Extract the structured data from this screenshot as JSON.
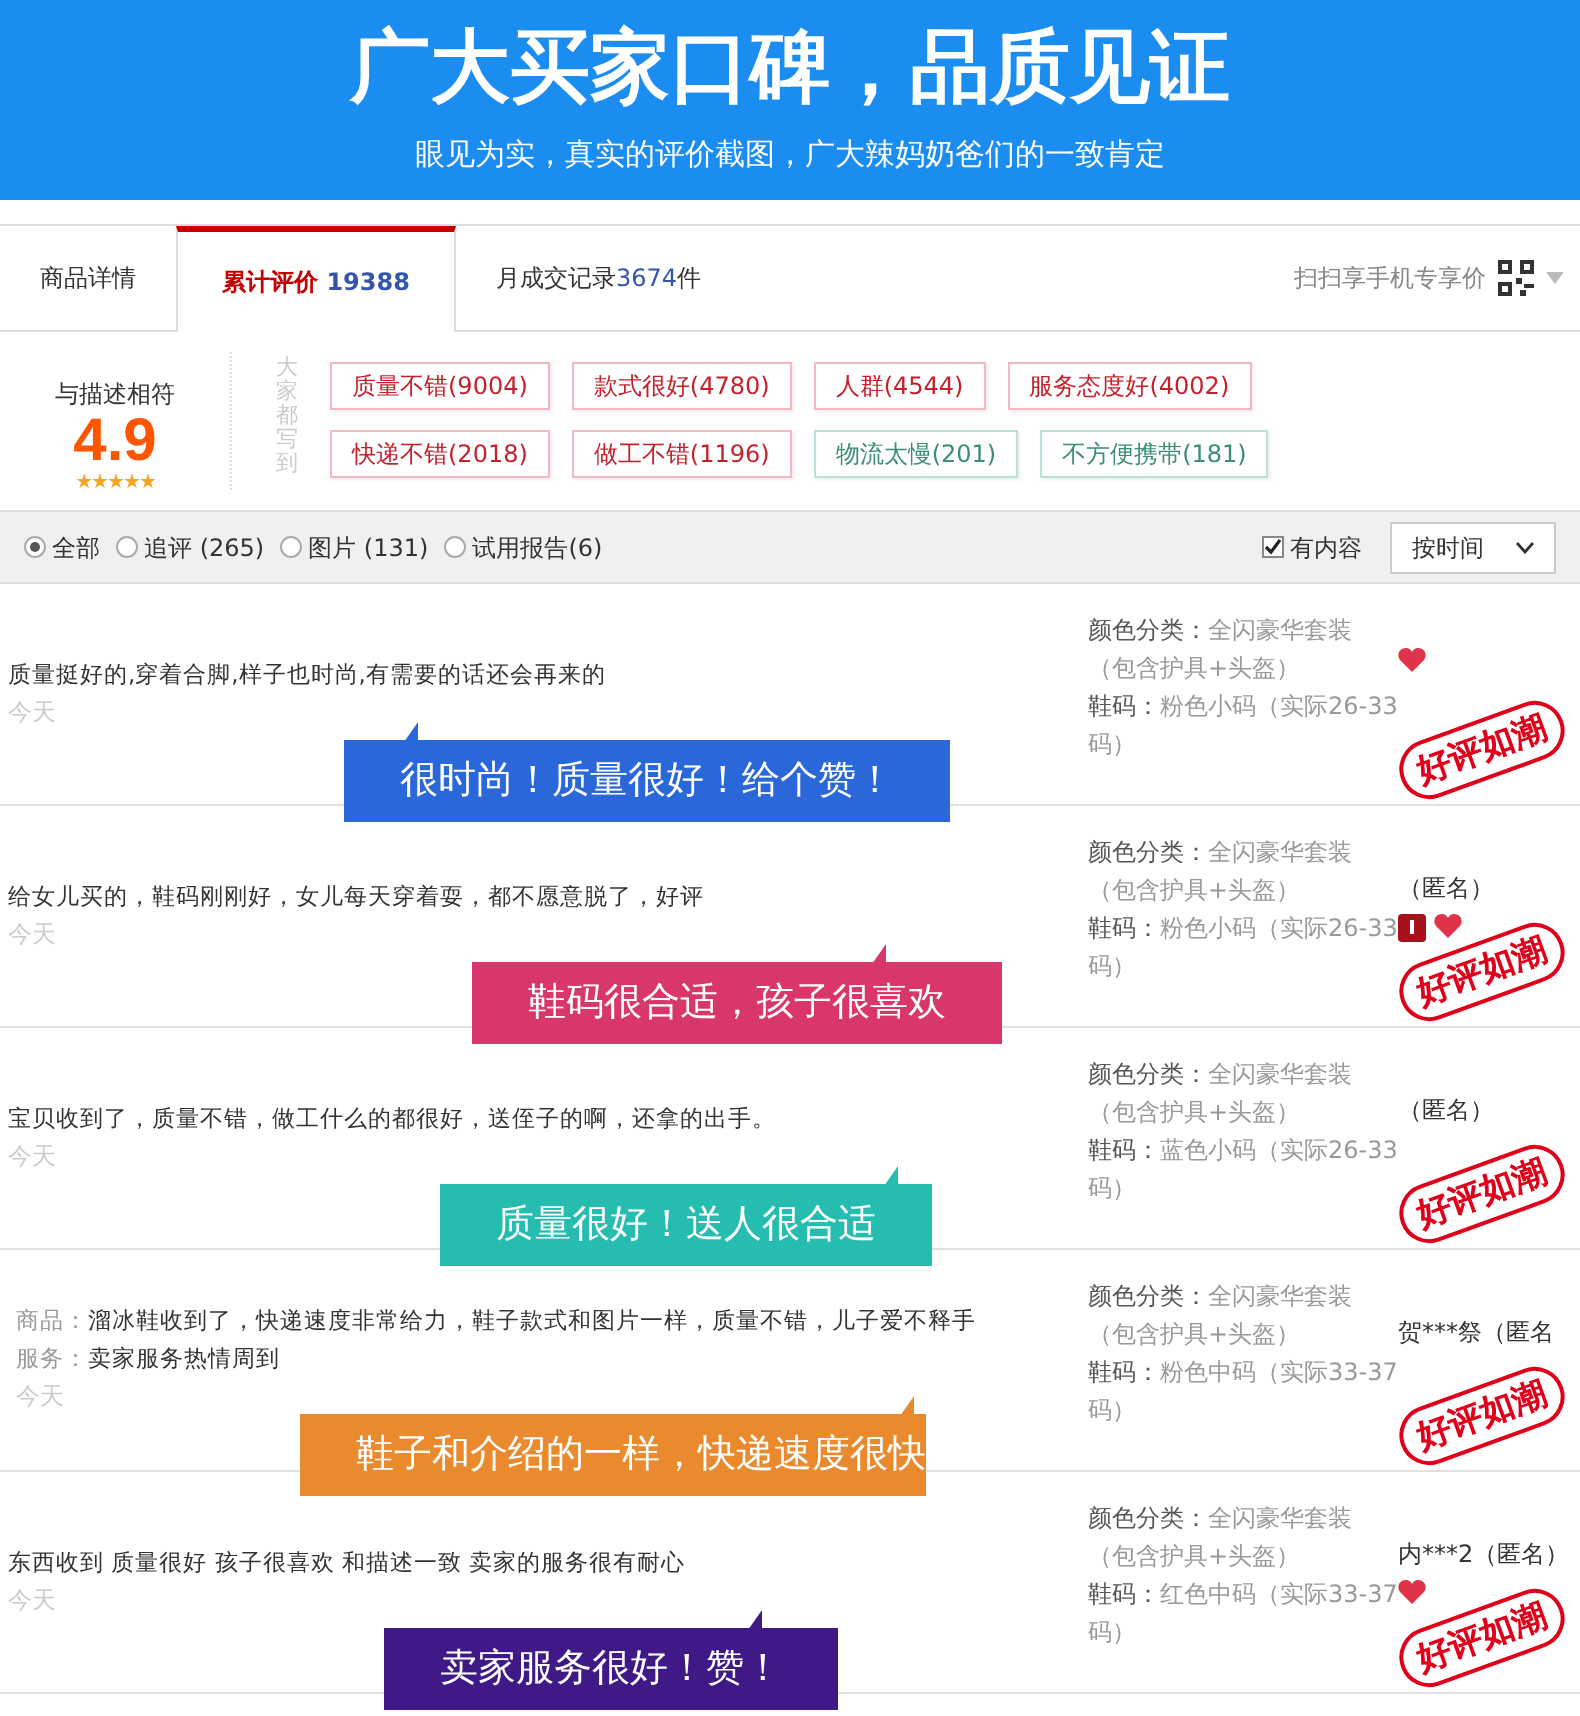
{
  "banner": {
    "title": "广大买家口碑，品质见证",
    "subtitle": "眼见为实，真实的评价截图，广大辣妈奶爸们的一致肯定"
  },
  "tabs": [
    {
      "label": "商品详情",
      "selected": false
    },
    {
      "label": "累计评价",
      "count": "19388",
      "selected": true
    },
    {
      "label": "月成交记录",
      "count": "3674",
      "suffix": "件",
      "selected": false
    }
  ],
  "mobile_price": "扫扫享手机专享价",
  "summary": {
    "label": "与描述相符",
    "score": "4.9",
    "stars": 5,
    "tags_title": "大家都写到"
  },
  "tags": [
    {
      "label": "质量不错(9004)",
      "color": "#c4212c"
    },
    {
      "label": "款式很好(4780)",
      "color": "#c4212c"
    },
    {
      "label": "人群(4544)",
      "color": "#c4212c"
    },
    {
      "label": "服务态度好(4002)",
      "color": "#c4212c"
    },
    {
      "label": "快递不错(2018)",
      "color": "#c4212c"
    },
    {
      "label": "做工不错(1196)",
      "color": "#c4212c"
    },
    {
      "label": "物流太慢(201)",
      "color": "#3b8c78"
    },
    {
      "label": "不方便携带(181)",
      "color": "#3b8c78"
    }
  ],
  "filters": [
    {
      "label": "全部",
      "selected": true
    },
    {
      "label": "追评 (265)",
      "selected": false
    },
    {
      "label": "图片 (131)",
      "selected": false
    },
    {
      "label": "试用报告(6)",
      "selected": false
    }
  ],
  "has_content": {
    "label": "有内容",
    "checked": true
  },
  "sort": "按时间",
  "reviews": [
    {
      "lines": [
        {
          "text": "质量挺好的,穿着合脚,样子也时尚,有需要的话还会再来的"
        }
      ],
      "date": "今天",
      "callout": "很时尚！质量很好！给个赞！",
      "color": "#2a67d8",
      "sku": [
        {
          "label": "颜色分类：",
          "value": "全闪豪华套装（包含护具+头盔）"
        },
        {
          "label": "鞋码：",
          "value": "粉色小码（实际26-33码）"
        }
      ],
      "badge": false,
      "heart": true,
      "stamp": "好评如潮"
    },
    {
      "lines": [
        {
          "text": "给女儿买的，鞋码刚刚好，女儿每天穿着耍，都不愿意脱了，好评"
        }
      ],
      "date": "今天",
      "callout": "鞋码很合适，孩子很喜欢",
      "color": "#d9376a",
      "sku": [
        {
          "label": "颜色分类：",
          "value": "全闪豪华套装（包含护具+头盔）"
        },
        {
          "label": "鞋码：",
          "value": "粉色小码（实际26-33码）"
        }
      ],
      "user": "（匿名）",
      "badge": true,
      "heart": true,
      "stamp": "好评如潮"
    },
    {
      "lines": [
        {
          "text": "宝贝收到了，质量不错，做工什么的都很好，送侄子的啊，还拿的出手。"
        }
      ],
      "date": "今天",
      "callout": "质量很好！送人很合适",
      "color": "#26bdb0",
      "sku": [
        {
          "label": "颜色分类：",
          "value": "全闪豪华套装（包含护具+头盔）"
        },
        {
          "label": "鞋码：",
          "value": "蓝色小码（实际26-33码）"
        }
      ],
      "user": "（匿名）",
      "badge": false,
      "heart": false,
      "stamp": "好评如潮"
    },
    {
      "lines": [
        {
          "label": "商品：",
          "text": "溜冰鞋收到了，快递速度非常给力，鞋子款式和图片一样，质量不错，儿子爱不释手"
        },
        {
          "label": "服务：",
          "text": "卖家服务热情周到"
        }
      ],
      "date": "今天",
      "callout": "鞋子和介绍的一样，快递速度很快",
      "color": "#e98a2e",
      "sku": [
        {
          "label": "颜色分类：",
          "value": "全闪豪华套装（包含护具+头盔）"
        },
        {
          "label": "鞋码：",
          "value": "粉色中码（实际33-37码）"
        }
      ],
      "user": "贺***祭（匿名",
      "badge": false,
      "heart": false,
      "stamp": "好评如潮"
    },
    {
      "lines": [
        {
          "text": "东西收到 质量很好 孩子很喜欢 和描述一致 卖家的服务很有耐心"
        }
      ],
      "date": "今天",
      "callout": "卖家服务很好！赞！",
      "color": "#3f1a86",
      "sku": [
        {
          "label": "颜色分类：",
          "value": "全闪豪华套装（包含护具+头盔）"
        },
        {
          "label": "鞋码：",
          "value": "红色中码（实际33-37码）"
        }
      ],
      "user": "内***2（匿名）",
      "badge": false,
      "heart": true,
      "stamp": "好评如潮"
    }
  ]
}
